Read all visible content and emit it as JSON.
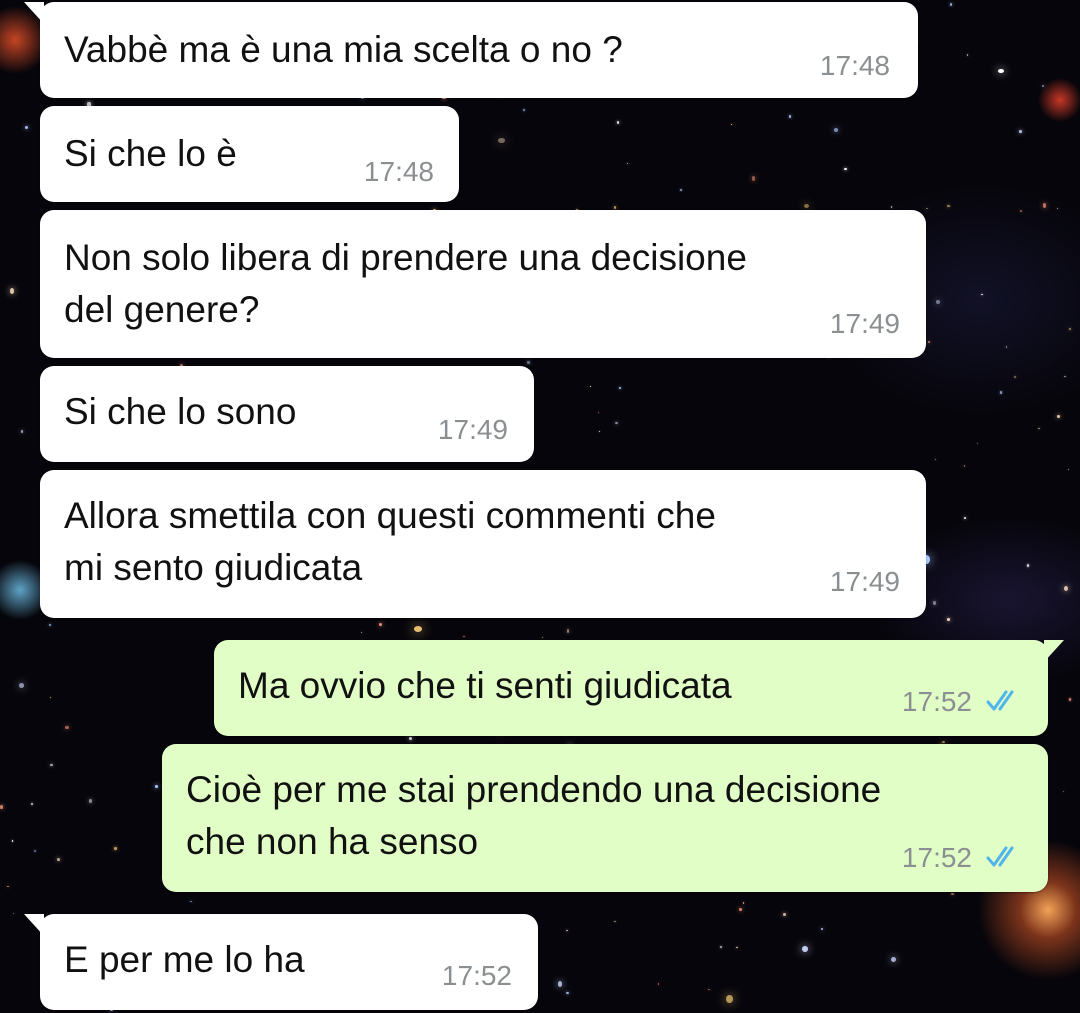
{
  "conversation": {
    "messages": [
      {
        "direction": "incoming",
        "text": "Vabbè ma è una mia scelta o no ?",
        "time": "17:48"
      },
      {
        "direction": "incoming",
        "text": "Si che lo è",
        "time": "17:48"
      },
      {
        "direction": "incoming",
        "text": "Non solo libera di prendere una decisione\ndel genere?",
        "time": "17:49"
      },
      {
        "direction": "incoming",
        "text": "Si che lo sono",
        "time": "17:49"
      },
      {
        "direction": "incoming",
        "text": "Allora smettila con questi commenti che\nmi sento giudicata",
        "time": "17:49"
      },
      {
        "direction": "outgoing",
        "text": "Ma ovvio che ti senti giudicata",
        "time": "17:52",
        "status_icon": "double-check-icon"
      },
      {
        "direction": "outgoing",
        "text": "Cioè per me stai prendendo una decisione\nche non ha senso",
        "time": "17:52",
        "status_icon": "double-check-icon"
      },
      {
        "direction": "incoming",
        "text": "E per me lo ha",
        "time": "17:52"
      }
    ]
  },
  "colors": {
    "incoming_bubble": "#ffffff",
    "outgoing_bubble": "#e2fec7",
    "read_ticks": "#4fb6ec",
    "timestamp": "#8b8f92",
    "background": "#06050b"
  },
  "background_style": "deep-space-galaxy-wallpaper"
}
